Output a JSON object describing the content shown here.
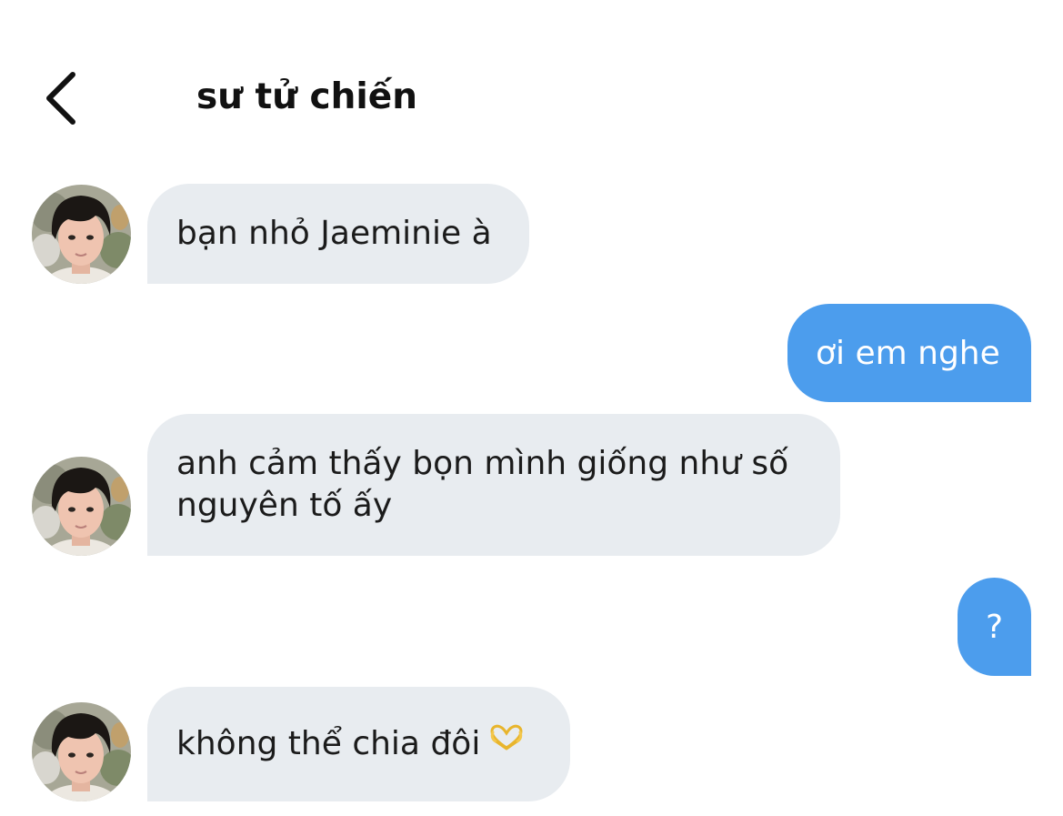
{
  "header": {
    "back_icon": "chevron-left-icon",
    "title": "sư tử chiến"
  },
  "messages": [
    {
      "direction": "incoming",
      "text": "bạn nhỏ Jaeminie à",
      "avatar": "profile-photo"
    },
    {
      "direction": "outgoing",
      "text": "ơi em nghe"
    },
    {
      "direction": "incoming",
      "lines": [
        "anh cảm thấy bọn mình giống như số",
        "nguyên tố ấy"
      ],
      "avatar": "profile-photo"
    },
    {
      "direction": "outgoing",
      "text": "?"
    },
    {
      "direction": "incoming",
      "text": "không thể chia đôi",
      "emoji": "heart-hands-emoji",
      "avatar": "profile-photo"
    }
  ],
  "colors": {
    "incoming_bubble": "#e8ecf0",
    "outgoing_bubble": "#4c9ded",
    "incoming_text": "#1b1b1b",
    "outgoing_text": "#ffffff",
    "title_text": "#111111"
  }
}
